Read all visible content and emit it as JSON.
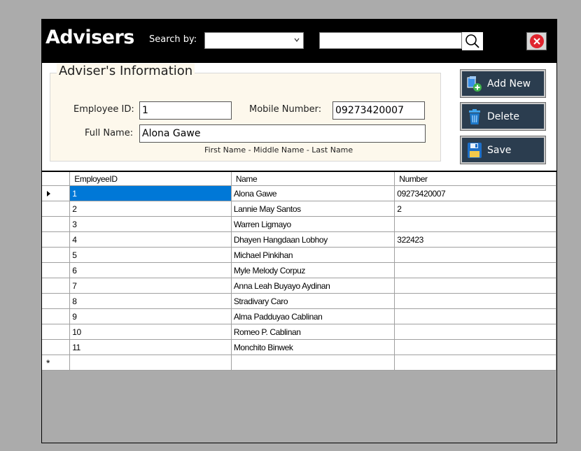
{
  "header": {
    "title": "Advisers",
    "search_label": "Search by:",
    "search_select_value": "",
    "search_text": ""
  },
  "info": {
    "group_title": "Adviser's Information",
    "employee_id_label": "Employee ID:",
    "employee_id_value": "1",
    "mobile_label": "Mobile Number:",
    "mobile_value": "09273420007",
    "fullname_label": "Full Name:",
    "fullname_value": "Alona Gawe",
    "name_hint": "First Name - Middle Name - Last Name"
  },
  "actions": {
    "add_label": "Add New",
    "delete_label": "Delete",
    "save_label": "Save"
  },
  "grid": {
    "columns": [
      "EmployeeID",
      "Name",
      "Number"
    ],
    "rows": [
      {
        "id": "1",
        "name": "Alona Gawe",
        "number": "09273420007"
      },
      {
        "id": "2",
        "name": "Lannie May Santos",
        "number": "2"
      },
      {
        "id": "3",
        "name": "Warren Ligmayo",
        "number": ""
      },
      {
        "id": "4",
        "name": "Dhayen Hangdaan Lobhoy",
        "number": "322423"
      },
      {
        "id": "5",
        "name": "Michael Pinkihan",
        "number": ""
      },
      {
        "id": "6",
        "name": "Myle Melody Corpuz",
        "number": ""
      },
      {
        "id": "7",
        "name": "Anna Leah Buyayo Aydinan",
        "number": ""
      },
      {
        "id": "8",
        "name": "Stradivary Caro",
        "number": ""
      },
      {
        "id": "9",
        "name": "Alma Padduyao Cablinan",
        "number": ""
      },
      {
        "id": "10",
        "name": "Romeo P. Cablinan",
        "number": ""
      },
      {
        "id": "11",
        "name": "Monchito Binwek",
        "number": ""
      }
    ],
    "selected_index": 0,
    "new_row_marker": "*"
  },
  "colors": {
    "header_bg": "#000000",
    "button_bg": "#2b3d4f",
    "selection": "#0078d7",
    "close_red": "#e0242e"
  }
}
